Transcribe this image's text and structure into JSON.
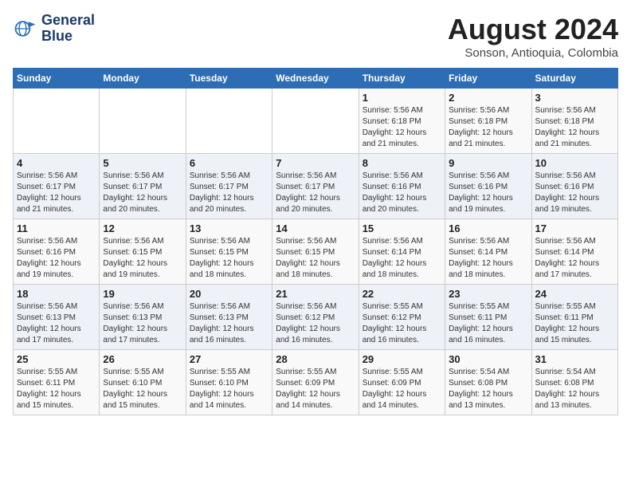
{
  "logo": {
    "line1": "General",
    "line2": "Blue"
  },
  "title": "August 2024",
  "subtitle": "Sonson, Antioquia, Colombia",
  "days_of_week": [
    "Sunday",
    "Monday",
    "Tuesday",
    "Wednesday",
    "Thursday",
    "Friday",
    "Saturday"
  ],
  "weeks": [
    [
      {
        "day": "",
        "info": ""
      },
      {
        "day": "",
        "info": ""
      },
      {
        "day": "",
        "info": ""
      },
      {
        "day": "",
        "info": ""
      },
      {
        "day": "1",
        "info": "Sunrise: 5:56 AM\nSunset: 6:18 PM\nDaylight: 12 hours\nand 21 minutes."
      },
      {
        "day": "2",
        "info": "Sunrise: 5:56 AM\nSunset: 6:18 PM\nDaylight: 12 hours\nand 21 minutes."
      },
      {
        "day": "3",
        "info": "Sunrise: 5:56 AM\nSunset: 6:18 PM\nDaylight: 12 hours\nand 21 minutes."
      }
    ],
    [
      {
        "day": "4",
        "info": "Sunrise: 5:56 AM\nSunset: 6:17 PM\nDaylight: 12 hours\nand 21 minutes."
      },
      {
        "day": "5",
        "info": "Sunrise: 5:56 AM\nSunset: 6:17 PM\nDaylight: 12 hours\nand 20 minutes."
      },
      {
        "day": "6",
        "info": "Sunrise: 5:56 AM\nSunset: 6:17 PM\nDaylight: 12 hours\nand 20 minutes."
      },
      {
        "day": "7",
        "info": "Sunrise: 5:56 AM\nSunset: 6:17 PM\nDaylight: 12 hours\nand 20 minutes."
      },
      {
        "day": "8",
        "info": "Sunrise: 5:56 AM\nSunset: 6:16 PM\nDaylight: 12 hours\nand 20 minutes."
      },
      {
        "day": "9",
        "info": "Sunrise: 5:56 AM\nSunset: 6:16 PM\nDaylight: 12 hours\nand 19 minutes."
      },
      {
        "day": "10",
        "info": "Sunrise: 5:56 AM\nSunset: 6:16 PM\nDaylight: 12 hours\nand 19 minutes."
      }
    ],
    [
      {
        "day": "11",
        "info": "Sunrise: 5:56 AM\nSunset: 6:16 PM\nDaylight: 12 hours\nand 19 minutes."
      },
      {
        "day": "12",
        "info": "Sunrise: 5:56 AM\nSunset: 6:15 PM\nDaylight: 12 hours\nand 19 minutes."
      },
      {
        "day": "13",
        "info": "Sunrise: 5:56 AM\nSunset: 6:15 PM\nDaylight: 12 hours\nand 18 minutes."
      },
      {
        "day": "14",
        "info": "Sunrise: 5:56 AM\nSunset: 6:15 PM\nDaylight: 12 hours\nand 18 minutes."
      },
      {
        "day": "15",
        "info": "Sunrise: 5:56 AM\nSunset: 6:14 PM\nDaylight: 12 hours\nand 18 minutes."
      },
      {
        "day": "16",
        "info": "Sunrise: 5:56 AM\nSunset: 6:14 PM\nDaylight: 12 hours\nand 18 minutes."
      },
      {
        "day": "17",
        "info": "Sunrise: 5:56 AM\nSunset: 6:14 PM\nDaylight: 12 hours\nand 17 minutes."
      }
    ],
    [
      {
        "day": "18",
        "info": "Sunrise: 5:56 AM\nSunset: 6:13 PM\nDaylight: 12 hours\nand 17 minutes."
      },
      {
        "day": "19",
        "info": "Sunrise: 5:56 AM\nSunset: 6:13 PM\nDaylight: 12 hours\nand 17 minutes."
      },
      {
        "day": "20",
        "info": "Sunrise: 5:56 AM\nSunset: 6:13 PM\nDaylight: 12 hours\nand 16 minutes."
      },
      {
        "day": "21",
        "info": "Sunrise: 5:56 AM\nSunset: 6:12 PM\nDaylight: 12 hours\nand 16 minutes."
      },
      {
        "day": "22",
        "info": "Sunrise: 5:55 AM\nSunset: 6:12 PM\nDaylight: 12 hours\nand 16 minutes."
      },
      {
        "day": "23",
        "info": "Sunrise: 5:55 AM\nSunset: 6:11 PM\nDaylight: 12 hours\nand 16 minutes."
      },
      {
        "day": "24",
        "info": "Sunrise: 5:55 AM\nSunset: 6:11 PM\nDaylight: 12 hours\nand 15 minutes."
      }
    ],
    [
      {
        "day": "25",
        "info": "Sunrise: 5:55 AM\nSunset: 6:11 PM\nDaylight: 12 hours\nand 15 minutes."
      },
      {
        "day": "26",
        "info": "Sunrise: 5:55 AM\nSunset: 6:10 PM\nDaylight: 12 hours\nand 15 minutes."
      },
      {
        "day": "27",
        "info": "Sunrise: 5:55 AM\nSunset: 6:10 PM\nDaylight: 12 hours\nand 14 minutes."
      },
      {
        "day": "28",
        "info": "Sunrise: 5:55 AM\nSunset: 6:09 PM\nDaylight: 12 hours\nand 14 minutes."
      },
      {
        "day": "29",
        "info": "Sunrise: 5:55 AM\nSunset: 6:09 PM\nDaylight: 12 hours\nand 14 minutes."
      },
      {
        "day": "30",
        "info": "Sunrise: 5:54 AM\nSunset: 6:08 PM\nDaylight: 12 hours\nand 13 minutes."
      },
      {
        "day": "31",
        "info": "Sunrise: 5:54 AM\nSunset: 6:08 PM\nDaylight: 12 hours\nand 13 minutes."
      }
    ]
  ]
}
